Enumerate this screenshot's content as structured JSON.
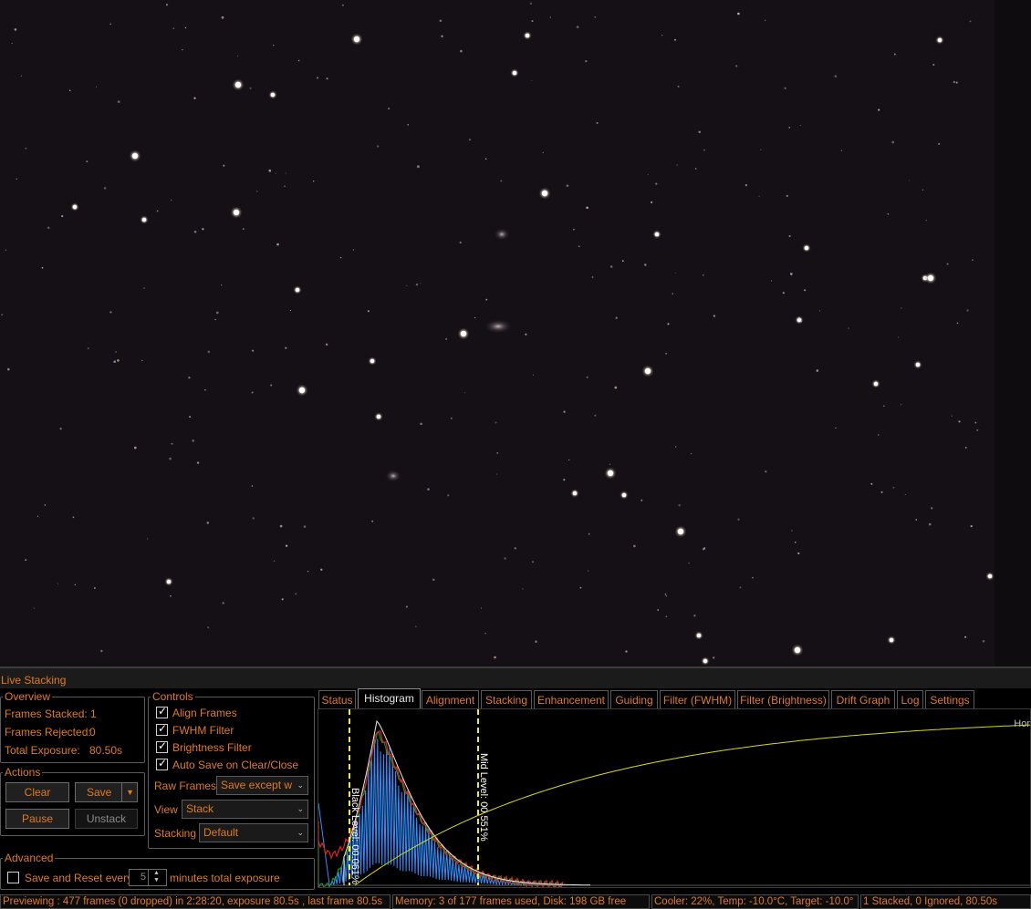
{
  "window": {
    "title": "Live Stacking"
  },
  "overview": {
    "legend": "Overview",
    "frames_stacked_label": "Frames Stacked:",
    "frames_stacked": "1",
    "frames_rejected_label": "Frames Rejected:",
    "frames_rejected": "0",
    "total_exposure_label": "Total Exposure:",
    "total_exposure": "80.50s"
  },
  "actions": {
    "legend": "Actions",
    "clear": "Clear",
    "save": "Save",
    "pause": "Pause",
    "unstack": "Unstack"
  },
  "controls": {
    "legend": "Controls",
    "align_frames": "Align Frames",
    "fwhm_filter": "FWHM Filter",
    "brightness_filter": "Brightness Filter",
    "auto_save": "Auto Save on Clear/Close",
    "raw_frames_label": "Raw Frames",
    "raw_frames_value": "Save except w",
    "view_label": "View",
    "view_value": "Stack",
    "stacking_label": "Stacking",
    "stacking_value": "Default"
  },
  "advanced": {
    "legend": "Advanced",
    "save_reset_label": "Save and Reset every",
    "minutes_value": "5",
    "minutes_label": "minutes total exposure"
  },
  "tabs": [
    "Status",
    "Histogram",
    "Alignment",
    "Stacking",
    "Enhancement",
    "Guiding",
    "Filter (FWHM)",
    "Filter (Brightness)",
    "Drift Graph",
    "Log",
    "Settings"
  ],
  "active_tab": "Histogram",
  "histogram": {
    "black_level": "Black Level: 00.061%",
    "mid_level": "Mid Level: 00.551%",
    "right_label": "Hor",
    "colors": {
      "red": "#e02020",
      "green": "#20a020",
      "blue": "#2f8fff",
      "curve": "#d8d820",
      "marker": "#f0f020"
    }
  },
  "status_bar": {
    "preview": "Previewing : 477 frames (0 dropped) in 2:28:20, exposure 80.5s , last frame 80.5s",
    "memory": "Memory: 3 of 177 frames used, Disk: 198 GB free",
    "cooler": "Cooler: 22%, Temp: -10.0°C, Target: -10.0°",
    "stack": "1 Stacked, 0 Ignored, 80.50s"
  },
  "colors": {
    "accent": "#e07a1f",
    "background": "#000000"
  }
}
